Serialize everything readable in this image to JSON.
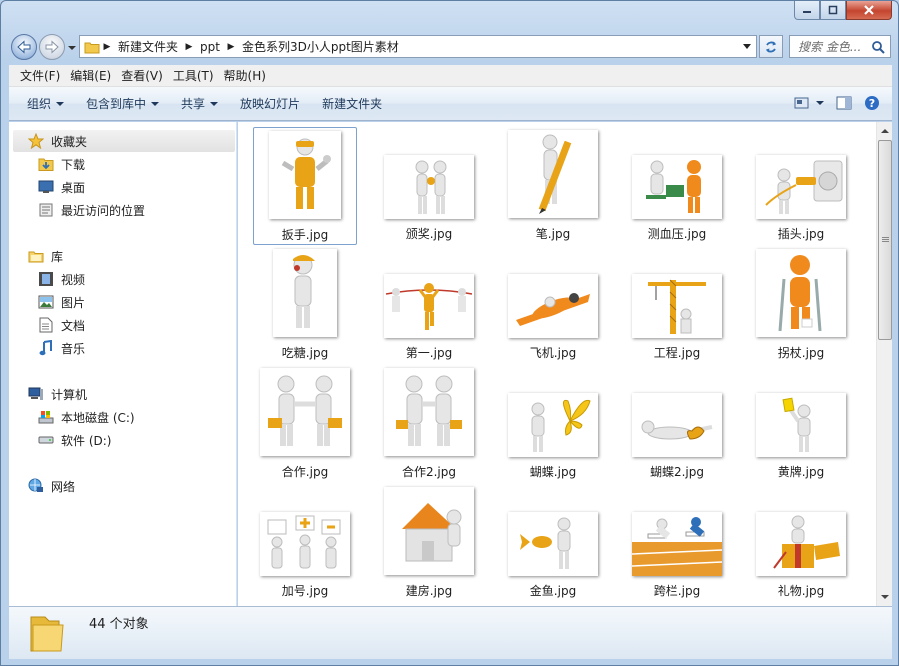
{
  "address": {
    "crumbs": [
      "新建文件夹",
      "ppt",
      "金色系列3D小人ppt图片素材"
    ]
  },
  "search": {
    "placeholder": "搜索 金色..."
  },
  "menu": [
    "文件(F)",
    "编辑(E)",
    "查看(V)",
    "工具(T)",
    "帮助(H)"
  ],
  "toolbar": {
    "organize": "组织",
    "include": "包含到库中",
    "share": "共享",
    "slideshow": "放映幻灯片",
    "new_folder": "新建文件夹"
  },
  "nav": {
    "favorites": "收藏夹",
    "downloads": "下载",
    "desktop": "桌面",
    "recent": "最近访问的位置",
    "libraries": "库",
    "videos": "视频",
    "pictures": "图片",
    "documents": "文档",
    "music": "音乐",
    "computer": "计算机",
    "drive_c": "本地磁盘 (C:)",
    "drive_d": "软件 (D:)",
    "network": "网络"
  },
  "files": [
    {
      "name": "扳手.jpg",
      "icon": "figure-wrench",
      "selected": true
    },
    {
      "name": "颁奖.jpg",
      "icon": "figure-award"
    },
    {
      "name": "笔.jpg",
      "icon": "figure-pen"
    },
    {
      "name": "测血压.jpg",
      "icon": "figure-blood-pressure"
    },
    {
      "name": "插头.jpg",
      "icon": "figure-plug"
    },
    {
      "name": "吃糖.jpg",
      "icon": "figure-candy"
    },
    {
      "name": "第一.jpg",
      "icon": "figure-finish-line"
    },
    {
      "name": "飞机.jpg",
      "icon": "figure-airplane"
    },
    {
      "name": "工程.jpg",
      "icon": "figure-crane"
    },
    {
      "name": "拐杖.jpg",
      "icon": "figure-crutches"
    },
    {
      "name": "合作.jpg",
      "icon": "figure-handshake"
    },
    {
      "name": "合作2.jpg",
      "icon": "figure-handshake"
    },
    {
      "name": "蝴蝶.jpg",
      "icon": "figure-butterfly"
    },
    {
      "name": "蝴蝶2.jpg",
      "icon": "figure-butterfly-crawl"
    },
    {
      "name": "黄牌.jpg",
      "icon": "figure-yellow-card"
    },
    {
      "name": "加号.jpg",
      "icon": "figure-plus-signs"
    },
    {
      "name": "建房.jpg",
      "icon": "figure-house"
    },
    {
      "name": "金鱼.jpg",
      "icon": "figure-goldfish"
    },
    {
      "name": "跨栏.jpg",
      "icon": "figure-hurdles"
    },
    {
      "name": "礼物.jpg",
      "icon": "figure-gift"
    }
  ],
  "status": {
    "count": "44 个对象"
  },
  "colors": {
    "gold": "#e8a317",
    "orange": "#f08a1c",
    "figure": "#e6e6e6",
    "accent": "#1e395b"
  }
}
